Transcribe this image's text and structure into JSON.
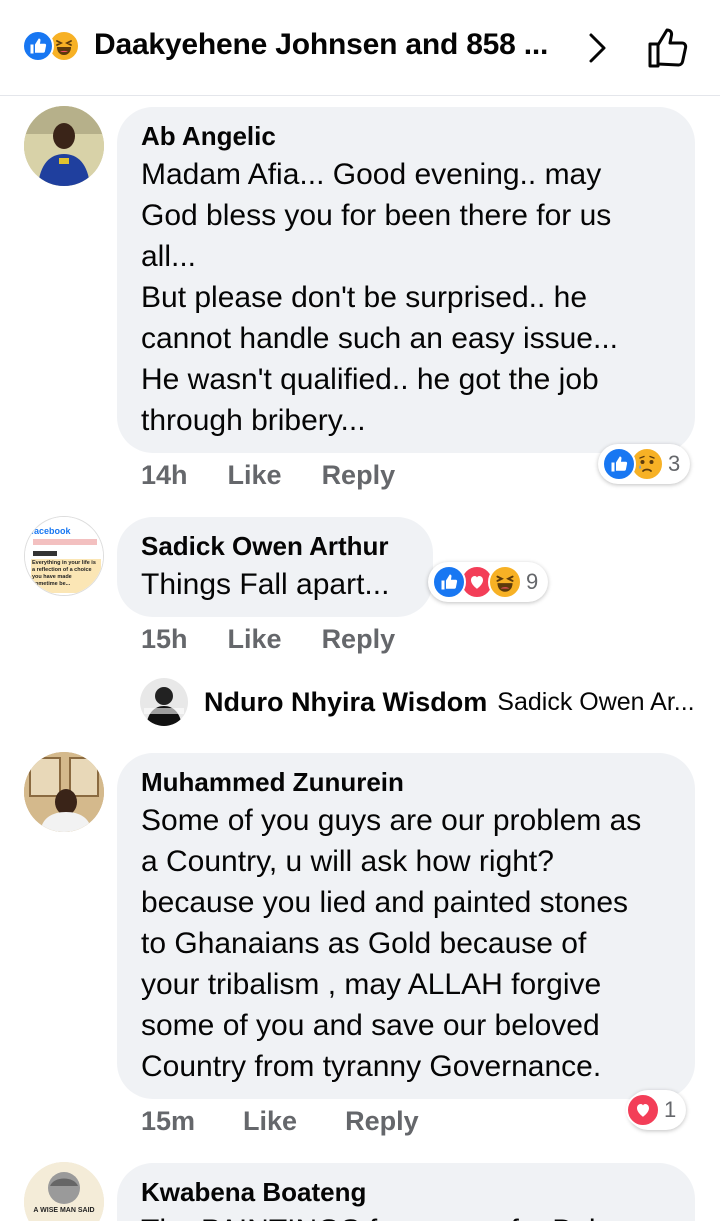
{
  "header": {
    "title": "Daakyehene Johnsen and 858 ...",
    "reactions": [
      "like-icon",
      "haha-icon"
    ]
  },
  "comments": [
    {
      "author": "Ab Angelic",
      "text": "Madam Afia... Good evening.. may\nGod bless you for been there for us\nall...\nBut please don't be surprised.. he\ncannot handle such an easy issue...\nHe wasn't qualified.. he got the job\nthrough bribery...",
      "time": "14h",
      "like_label": "Like",
      "reply_label": "Reply",
      "reactions": [
        "like-icon",
        "sad-icon"
      ],
      "reaction_count": "3"
    },
    {
      "author": "Sadick Owen Arthur",
      "text": "Things Fall apart...",
      "time": "15h",
      "like_label": "Like",
      "reply_label": "Reply",
      "reactions": [
        "like-icon",
        "love-icon",
        "haha-icon"
      ],
      "reaction_count": "9",
      "reply_preview": {
        "author": "Nduro Nhyira Wisdom",
        "text": "Sadick Owen Ar..."
      },
      "avatar_text": {
        "brand": "facebook",
        "quote": "Everything in your life is a reflection of a choice you have made sometime be..."
      }
    },
    {
      "author": "Muhammed Zunurein",
      "text": "Some of you guys are our problem as\na Country, u will ask how right?\nbecause you lied and painted stones\nto Ghanaians as Gold because of\nyour tribalism , may ALLAH forgive\nsome of you and save our beloved\nCountry from tyranny Governance.",
      "time": "15m",
      "like_label": "Like",
      "reply_label": "Reply",
      "reactions": [
        "love-icon"
      ],
      "reaction_count": "1"
    },
    {
      "author": "Kwabena Boateng",
      "text": "The PAINTINGS for some of... Bob...",
      "avatar_text": "A WISE MAN SAID"
    }
  ],
  "colors": {
    "bubble": "#f0f2f5",
    "meta_text": "#65676b",
    "like_blue": "#1877f2",
    "love_red": "#f33e58",
    "haha_yellow": "#f7b125"
  }
}
